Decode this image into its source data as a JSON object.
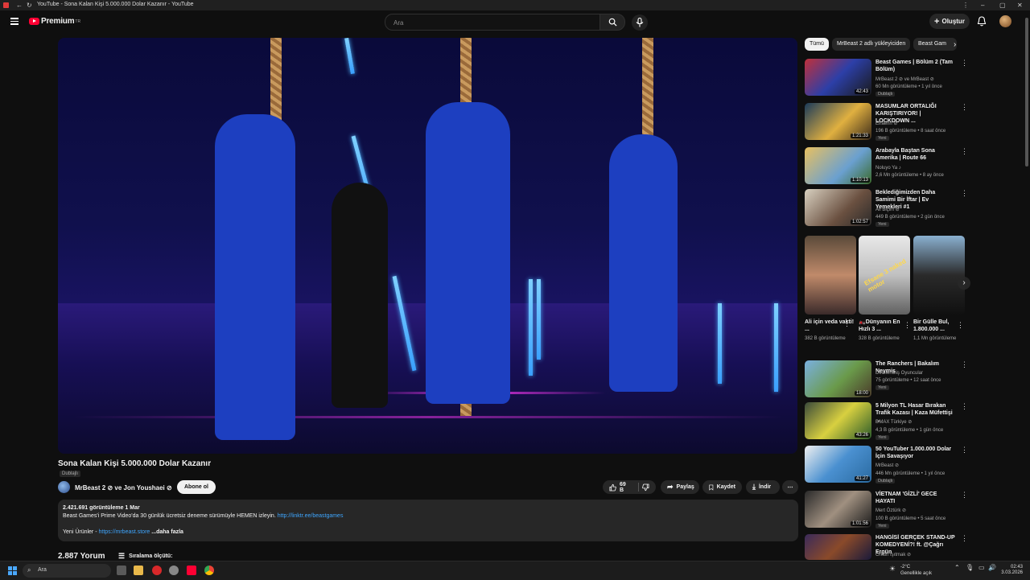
{
  "browser": {
    "tab_title": "YouTube - Sona Kalan Kişi 5.000.000 Dolar Kazanır - YouTube"
  },
  "header": {
    "logo": "Premium",
    "logo_region": "TR",
    "search_placeholder": "Ara",
    "create_label": "Oluştur"
  },
  "video": {
    "title": "Sona Kalan Kişi 5.000.000 Dolar Kazanır",
    "dubbed_label": "Dublajlı",
    "channel": "MrBeast 2 ⊘ ve Jon Youshaei ⊘",
    "subscribe_label": "Abone ol",
    "likes": "69 B",
    "share_label": "Paylaş",
    "save_label": "Kaydet",
    "download_label": "İndir",
    "views_date": "2.421.691 görüntüleme  1 Mar",
    "desc_line1": "Beast Games'i Prime Video'da 30 günlük ücretsiz deneme sürümüyle HEMEN izleyin.",
    "desc_link1": "http://linktr.ee/beastgames",
    "desc_line2_prefix": "Yeni Ürünler - ",
    "desc_link2": "https://mrbeast.store",
    "more_label": "...daha fazla",
    "comments_count": "2.887 Yorum",
    "sort_label": "Sıralama ölçütü:"
  },
  "chips": [
    "Tümü",
    "MrBeast 2 adlı yükleyiciden",
    "Beast Gam"
  ],
  "recommendations": [
    {
      "title": "Beast Games | Bölüm 2 (Tam Bölüm)",
      "channel": "MrBeast 2 ⊘ ve MrBeast ⊘",
      "meta": "60 Mn görüntüleme • 1 yıl önce",
      "badge": "Dublajlı",
      "duration": "42:43"
    },
    {
      "title": "MASUMLAR ORTALIĞI KARIŞTIRIYOR! | LOCKDOWN ...",
      "channel": "Elraenn ⊘",
      "meta": "196 B görüntüleme • 8 saat önce",
      "badge": "Yeni",
      "duration": "1:21:33"
    },
    {
      "title": "Arabayla Baştan Sona Amerika | Route 66",
      "channel": "Noluyo Ya ♪",
      "meta": "2,6 Mn görüntüleme • 8 ay önce",
      "badge": "",
      "duration": "1:10:13"
    },
    {
      "title": "Beklediğimizden Daha Samimi Bir İftar | Ev Yemekleri #1",
      "channel": "Ali Biçim ⊘",
      "meta": "449 B görüntüleme • 2 gün önce",
      "badge": "Yeni",
      "duration": "1:02:57"
    },
    {
      "title": "The Ranchers | Bakalım Neymiş",
      "channel": "Demlenmiş Oyuncular",
      "meta": "75 görüntüleme • 12 saat önce",
      "badge": "Yeni",
      "duration": "18:00"
    },
    {
      "title": "5 Milyon TL Hasar Bırakan Trafik Kazası | Kaza Müfettişi ...",
      "channel": "DMAX Türkiye ⊘",
      "meta": "4,3 B görüntüleme • 1 gün önce",
      "badge": "Yeni",
      "duration": "43:26"
    },
    {
      "title": "50 YouTuber 1.000.000 Dolar İçin Savaşıyor",
      "channel": "MrBeast ⊘",
      "meta": "446 Mn görüntüleme • 1 yıl önce",
      "badge": "Dublajlı",
      "duration": "41:27"
    },
    {
      "title": "VİETNAM 'GİZLİ' GECE HAYATI",
      "channel": "Mert Öztürk ⊘",
      "meta": "100 B görüntüleme • 5 saat önce",
      "badge": "Yeni",
      "duration": "1:01:56"
    },
    {
      "title": "HANGİSİ GERÇEK STAND-UP KOMEDYENİ?! ft. @Çağrı Ergün",
      "channel": "Orkun Işıtmak ⊘",
      "meta": "",
      "badge": "",
      "duration": ""
    }
  ],
  "shorts": [
    {
      "title": "Ali için veda vakti! ...",
      "views": "382 B görüntüleme"
    },
    {
      "title": "🏍️Dünyanın En Hızlı 3 ...",
      "views": "328 B görüntüleme"
    },
    {
      "title": "Bir Gülle Bul, 1.800.000 ...",
      "views": "1,1 Mn görüntüleme"
    }
  ],
  "shorts_overlay": {
    "thumb2": "Efsane 3 naked motor"
  },
  "taskbar": {
    "search_placeholder": "Ara",
    "weather_temp": "-2°C",
    "weather_desc": "Genellikle açık",
    "time": "02:43",
    "date": "3.03.2026"
  },
  "colors": {
    "brand_red": "#ff0033",
    "link": "#3ea6ff",
    "bg": "#0f0f0f"
  }
}
